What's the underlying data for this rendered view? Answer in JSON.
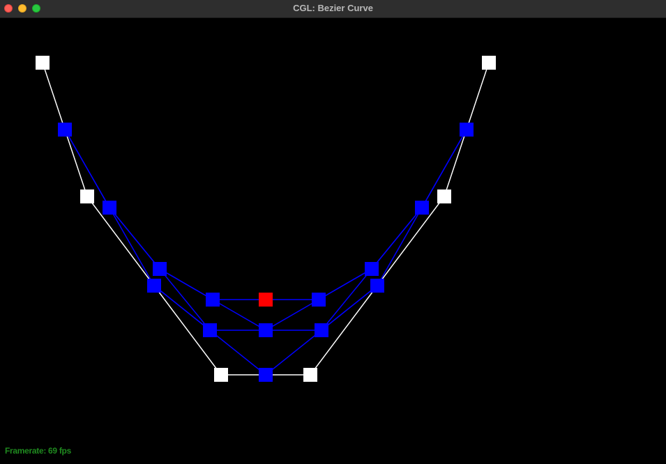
{
  "window": {
    "title": "CGL: Bezier Curve"
  },
  "status": {
    "framerate_text": "Framerate: 69 fps"
  },
  "colors": {
    "control_point": "#ffffff",
    "control_polygon": "#ffffff",
    "intermediate_point": "#0000ff",
    "intermediate_line": "#0000ff",
    "curve_point": "#ff0000",
    "background": "#000000"
  }
}
